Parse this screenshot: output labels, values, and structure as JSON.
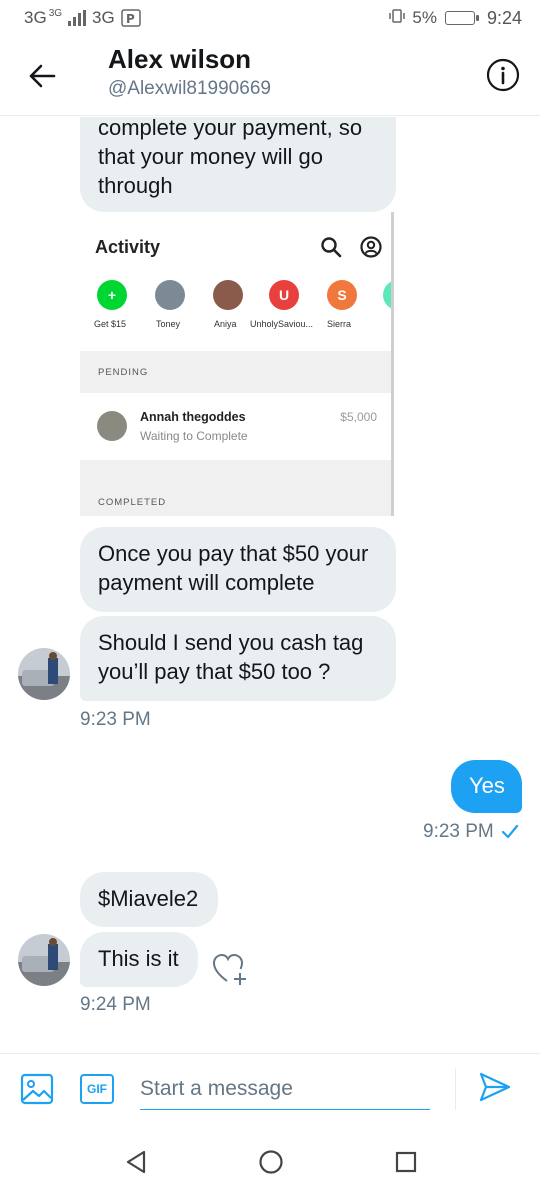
{
  "status_bar": {
    "network_left": "3G",
    "network_small": "3G",
    "network_mid": "3G",
    "battery": "5%",
    "time": "9:24"
  },
  "header": {
    "name": "Alex wilson",
    "handle": "@Alexwil81990669",
    "back_icon": "arrow-left-icon",
    "info_icon": "info-icon"
  },
  "messages": {
    "m1": "complete your payment, so that your money will go through",
    "m2": "Once you pay that $50 your payment will complete",
    "m3": "Should I send you cash tag you’ll pay that $50 too ?",
    "t1": "9:23 PM",
    "m4": "Yes",
    "t2": "9:23 PM",
    "m5": "$Miavele2",
    "m6": "This is it",
    "t3": "9:24 PM"
  },
  "shared_screenshot": {
    "title": "Activity",
    "contacts": [
      {
        "label": "Get $15",
        "initial": "+",
        "color": "#00d632"
      },
      {
        "label": "Toney",
        "initial": "",
        "color": "#7c8a96"
      },
      {
        "label": "Aniya",
        "initial": "",
        "color": "#8a5a4a"
      },
      {
        "label": "UnholySaviou...",
        "initial": "U",
        "color": "#e8403c"
      },
      {
        "label": "Sierra",
        "initial": "S",
        "color": "#f0783c"
      }
    ],
    "pending_label": "PENDING",
    "pending_name": "Annah thegoddes",
    "pending_status": "Waiting to Complete",
    "pending_amount": "$5,000",
    "completed_label": "COMPLETED"
  },
  "composer": {
    "placeholder": "Start a message",
    "gif_label": "GIF"
  },
  "colors": {
    "accent": "#1da1f2",
    "bubble_in": "#e9eef1",
    "muted": "#657786"
  }
}
